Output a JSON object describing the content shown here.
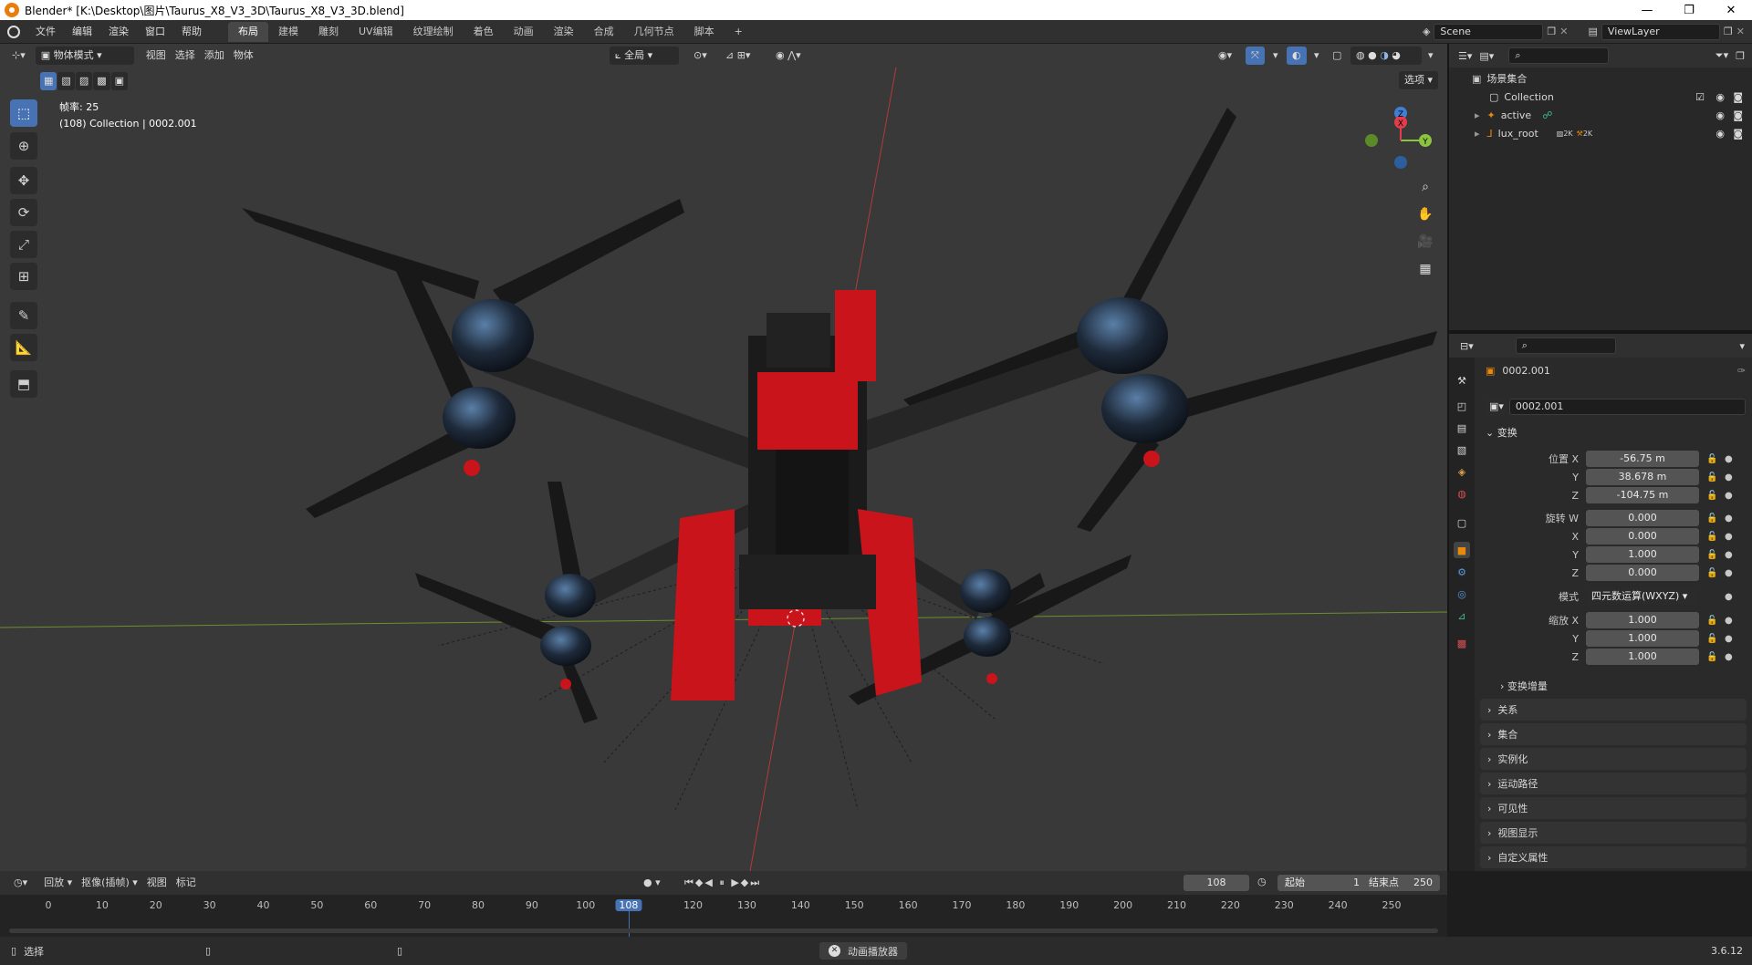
{
  "window": {
    "title": "Blender* [K:\\Desktop\\图片\\Taurus_X8_V3_3D\\Taurus_X8_V3_3D.blend]",
    "minimize": "—",
    "maximize": "❐",
    "close": "✕"
  },
  "menu": {
    "items": [
      "文件",
      "编辑",
      "渲染",
      "窗口",
      "帮助"
    ]
  },
  "workspaces": {
    "tabs": [
      "布局",
      "建模",
      "雕刻",
      "UV编辑",
      "纹理绘制",
      "着色",
      "动画",
      "渲染",
      "合成",
      "几何节点",
      "脚本"
    ],
    "active": 0,
    "add": "+"
  },
  "scene": {
    "name": "Scene",
    "view_layer": "ViewLayer"
  },
  "viewport": {
    "mode": "物体模式",
    "menus": [
      "视图",
      "选择",
      "添加",
      "物体"
    ],
    "transform_orientation": "全局",
    "options_label": "选项",
    "overlay_info": {
      "fps": "帧率: 25",
      "object": "(108) Collection | 0002.001"
    },
    "gizmo": {
      "x": "X",
      "y": "Y",
      "z": "Z"
    }
  },
  "outliner": {
    "root": "场景集合",
    "items": [
      {
        "name": "Collection",
        "indent": 1
      },
      {
        "name": "active",
        "indent": 1
      },
      {
        "name": "lux_root",
        "indent": 1
      }
    ],
    "badges": [
      "2K",
      "2K"
    ]
  },
  "properties": {
    "object_name": "0002.001",
    "data_name": "0002.001",
    "transform_section": "变换",
    "location": {
      "label": "位置 X",
      "x": "-56.75 m",
      "y": "38.678 m",
      "z": "-104.75 m"
    },
    "rotation": {
      "label_w": "旋转 W",
      "w": "0.000",
      "x": "0.000",
      "y": "1.000",
      "z": "0.000"
    },
    "mode": {
      "label": "模式",
      "value": "四元数运算(WXYZ)"
    },
    "scale": {
      "label": "缩放 X",
      "x": "1.000",
      "y": "1.000",
      "z": "1.000"
    },
    "axis_labels": {
      "y": "Y",
      "z": "Z",
      "x": "X"
    },
    "delta_transform": "变换增量",
    "sections": [
      "关系",
      "集合",
      "实例化",
      "运动路径",
      "可见性",
      "视图显示",
      "自定义属性"
    ]
  },
  "timeline": {
    "menus": [
      "回放",
      "抠像(插帧)",
      "视图",
      "标记"
    ],
    "current_frame": "108",
    "start_label": "起始",
    "start": "1",
    "end_label": "结束点",
    "end": "250",
    "ticks": [
      "0",
      "10",
      "20",
      "30",
      "40",
      "50",
      "60",
      "70",
      "80",
      "90",
      "100",
      "108",
      "120",
      "130",
      "140",
      "150",
      "160",
      "170",
      "180",
      "190",
      "200",
      "210",
      "220",
      "230",
      "240",
      "250"
    ],
    "tick_frames": [
      0,
      10,
      20,
      30,
      40,
      50,
      60,
      70,
      80,
      90,
      100,
      108,
      120,
      130,
      140,
      150,
      160,
      170,
      180,
      190,
      200,
      210,
      220,
      230,
      240,
      250
    ]
  },
  "status": {
    "left": "选择",
    "center": "动画播放器",
    "version": "3.6.12"
  },
  "colors": {
    "accent": "#4772b3",
    "x_axis": "#e23c4d",
    "y_axis": "#8bc53f",
    "z_axis": "#3f7fd4",
    "drone_red": "#c8141a",
    "object_orange": "#e8890c"
  }
}
